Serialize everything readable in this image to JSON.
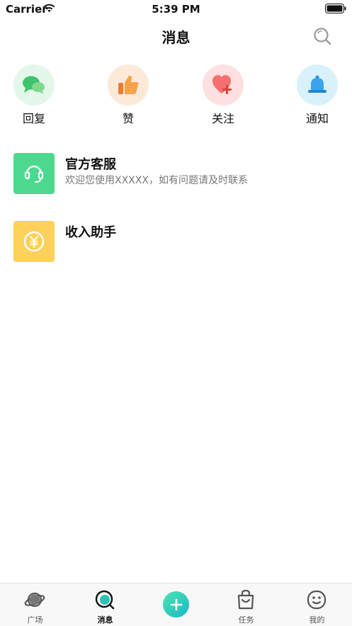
{
  "status_bar": {
    "carrier": "Carrier",
    "time": "5:39 PM"
  },
  "nav": {
    "title": "消息",
    "search_icon": "search-icon"
  },
  "quick_actions": [
    {
      "label": "回复",
      "icon": "chat-bubbles-icon",
      "bg": "#e3f7ea"
    },
    {
      "label": "赞",
      "icon": "thumbs-up-icon",
      "bg": "#fde9d8"
    },
    {
      "label": "关注",
      "icon": "heart-plus-icon",
      "bg": "#fde0df"
    },
    {
      "label": "通知",
      "icon": "bell-icon",
      "bg": "#d9f1fb"
    }
  ],
  "messages": [
    {
      "title": "官方客服",
      "subtitle": "欢迎您使用XXXXX，如有问题请及时联系",
      "icon": "headset-icon",
      "color": "#4cd98e"
    },
    {
      "title": "收入助手",
      "subtitle": "",
      "icon": "yuan-coin-icon",
      "color": "#fdd15a"
    }
  ],
  "tab_bar": {
    "tabs": [
      {
        "label": "广场",
        "icon": "planet-icon"
      },
      {
        "label": "消息",
        "icon": "message-icon",
        "active": true
      },
      {
        "label": "",
        "icon": "add-icon"
      },
      {
        "label": "任务",
        "icon": "shopping-bag-icon"
      },
      {
        "label": "我的",
        "icon": "smiley-face-icon"
      }
    ]
  }
}
